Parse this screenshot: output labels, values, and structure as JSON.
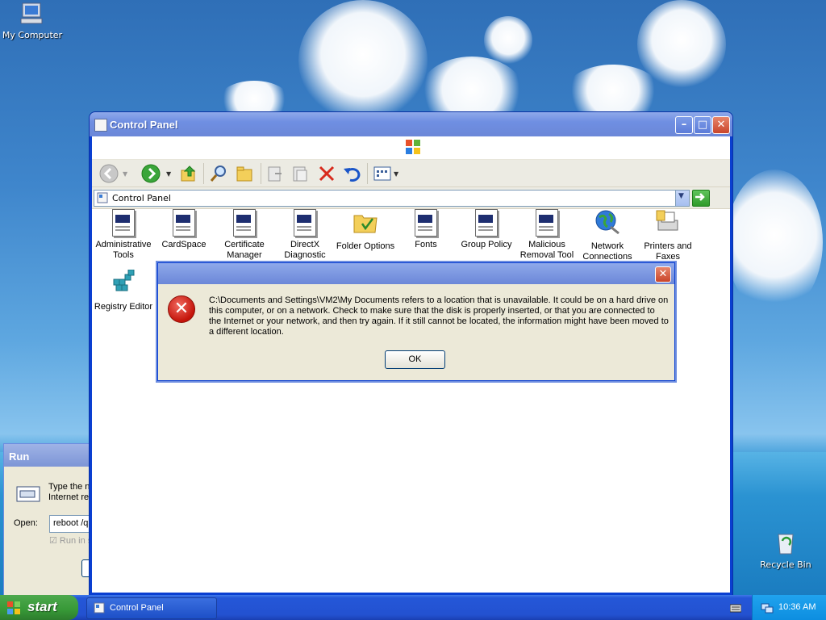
{
  "desktop": {
    "icons": {
      "my_computer": "My Computer",
      "recycle_bin": "Recycle Bin"
    }
  },
  "control_panel": {
    "title": "Control Panel",
    "address": "Control Panel",
    "items": [
      {
        "label": "Administrative Tools",
        "icon": "doc-icon"
      },
      {
        "label": "CardSpace",
        "icon": "doc-icon"
      },
      {
        "label": "Certificate Manager",
        "icon": "doc-icon"
      },
      {
        "label": "DirectX Diagnostic",
        "icon": "doc-icon"
      },
      {
        "label": "Folder Options",
        "icon": "folder-options-icon"
      },
      {
        "label": "Fonts",
        "icon": "doc-icon"
      },
      {
        "label": "Group Policy",
        "icon": "doc-icon"
      },
      {
        "label": "Malicious Removal Tool",
        "icon": "doc-icon"
      },
      {
        "label": "Network Connections",
        "icon": "globe-icon"
      },
      {
        "label": "Printers and Faxes",
        "icon": "printer-icon"
      },
      {
        "label": "Registry Editor",
        "icon": "registry-icon"
      }
    ]
  },
  "error_dialog": {
    "message": "C:\\Documents and Settings\\VM2\\My Documents refers to a location that is unavailable. It could be on a hard drive on this computer, or on a network. Check to make sure that the disk is properly inserted, or that you are connected to the Internet or your network, and then try again. If it still cannot be located, the information might have been moved to a different location.",
    "ok_label": "OK"
  },
  "run_dialog": {
    "title": "Run",
    "text_line1": "Type the n",
    "text_line2": "Internet re",
    "open_label": "Open:",
    "input_value": "reboot /q",
    "checkbox_label": "Run in s"
  },
  "taskbar": {
    "start_label": "start",
    "task_label": "Control Panel",
    "clock": "10:36 AM"
  }
}
